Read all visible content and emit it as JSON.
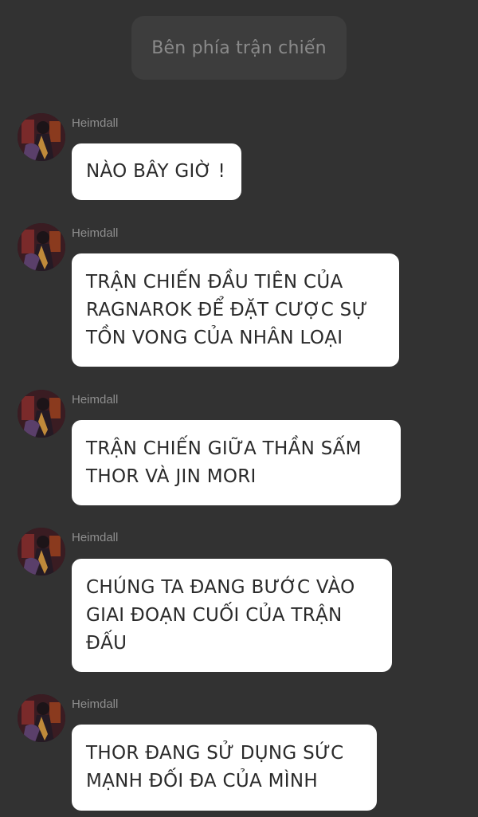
{
  "header": {
    "system_label": "Bên phía trận chiến"
  },
  "messages": [
    {
      "sender": "Heimdall",
      "text": "NÀO BÂY GIỜ !"
    },
    {
      "sender": "Heimdall",
      "text": "TRẬN CHIẾN ĐẦU TIÊN CỦA\nRAGNAROK ĐỂ ĐẶT CƯỢC SỰ\nTỒN VONG CỦA NHÂN LOẠI"
    },
    {
      "sender": "Heimdall",
      "text": "TRẬN CHIẾN GIỮA THẦN SẤM\nTHOR VÀ JIN MORI"
    },
    {
      "sender": "Heimdall",
      "text": "CHÚNG TA ĐANG BƯỚC VÀO\nGIAI ĐOẠN CUỐI CỦA TRẬN\nĐẤU"
    },
    {
      "sender": "Heimdall",
      "text": "THOR ĐANG SỬ DỤNG SỨC\nMẠNH ĐỐI ĐA CỦA MÌNH"
    }
  ],
  "colors": {
    "background": "#323232",
    "bubble": "#ffffff",
    "system_pill": "#3d3d3d"
  },
  "icons": {
    "avatar": "heimdall-avatar-icon"
  }
}
